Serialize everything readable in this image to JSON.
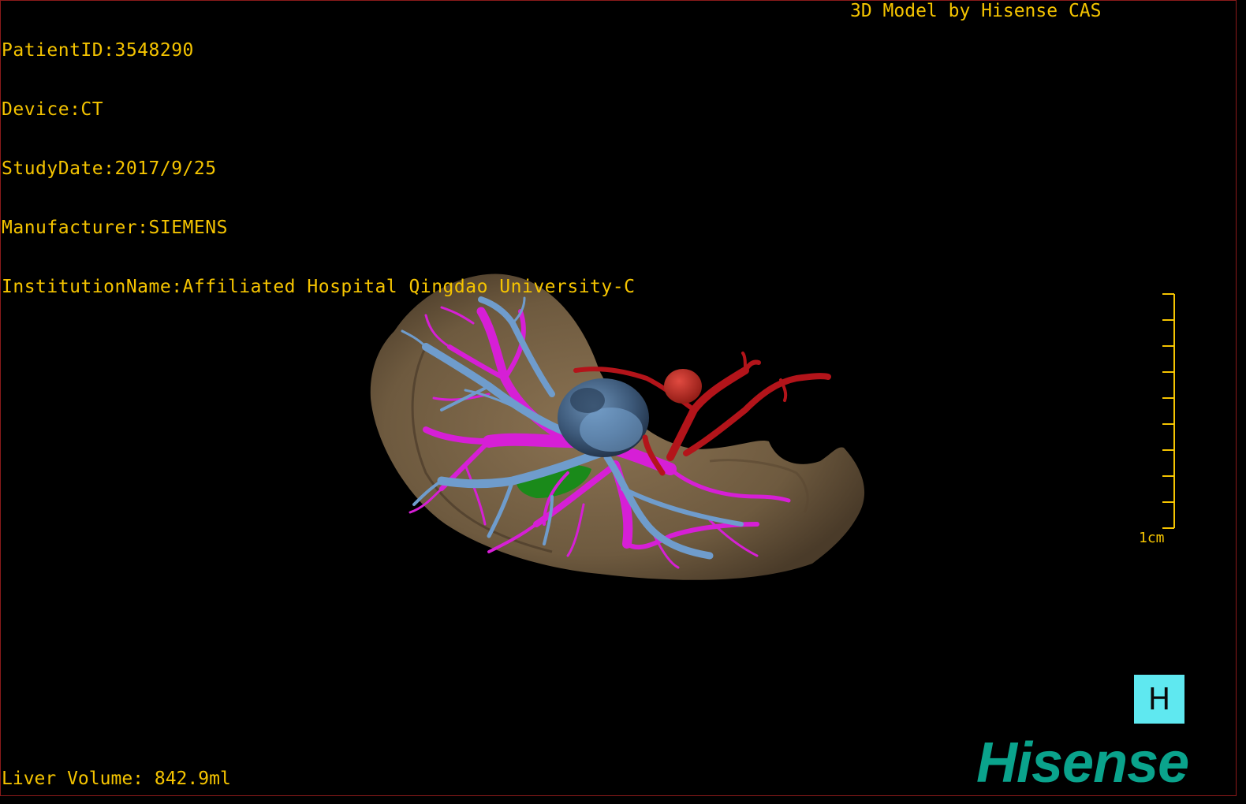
{
  "dicom_info": {
    "patient_id": "PatientID:3548290",
    "device": "Device:CT",
    "study_date": "StudyDate:2017/9/25",
    "manufacturer": "Manufacturer:SIEMENS",
    "institution": "InstitutionName:Affiliated Hospital Qingdao University-C"
  },
  "header_brand": "3D Model by Hisense CAS",
  "liver_volume": "Liver Volume: 842.9ml",
  "scale_bar": {
    "label": "1cm"
  },
  "orientation_button": {
    "label": "H"
  },
  "logo_text": "Hisense",
  "colors": {
    "text": "#f5c400",
    "liver": "#7a6447",
    "portal_vein": "#d61fd6",
    "hepatic_vein": "#6f9ccc",
    "artery": "#b3141a",
    "gallbladder": "#1a8a1a",
    "orientation_bg": "#5fe8f0",
    "logo": "#0aa38c"
  },
  "model_structures": [
    "liver",
    "portal-vein",
    "hepatic-vein",
    "hepatic-artery",
    "tumor",
    "gallbladder"
  ]
}
